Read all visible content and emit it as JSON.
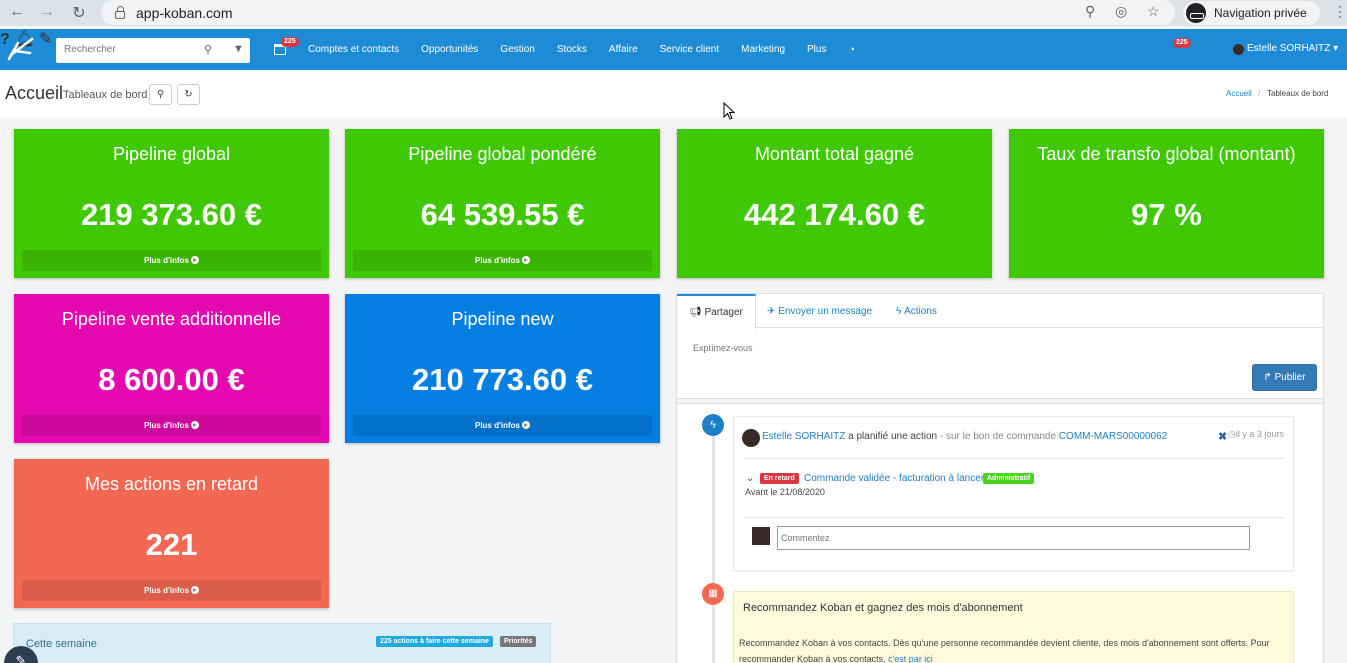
{
  "browser": {
    "url": "app-koban.com",
    "private_label": "Navigation privée"
  },
  "navbar": {
    "search_placeholder": "Rechercher",
    "calendar_badge": "225",
    "menu": [
      "Comptes et contacts",
      "Opportunités",
      "Gestion",
      "Stocks",
      "Affaire",
      "Service client",
      "Marketing",
      "Plus"
    ],
    "notif_badge": "225",
    "user_name": "Estelle SORHAITZ"
  },
  "page": {
    "title": "Accueil",
    "subtitle": "Tableaux de bord",
    "breadcrumb": [
      "Accueil",
      "Tableaux de bord"
    ]
  },
  "colors": {
    "brand_blue": "#1e8bd7",
    "kpi_green": "#41c804",
    "kpi_magenta": "#e40aaf",
    "kpi_blue": "#047ee0",
    "kpi_red": "#f26852",
    "late_red": "#d9363e",
    "admin_green": "#4bd31d"
  },
  "kpis": [
    {
      "title": "Pipeline global",
      "value": "219 373.60 €",
      "more": "Plus d'infos"
    },
    {
      "title": "Pipeline global pondéré",
      "value": "64 539.55 €",
      "more": "Plus d'infos"
    },
    {
      "title": "Montant total gagné",
      "value": "442 174.60 €",
      "more": ""
    },
    {
      "title": "Taux de transfo global (montant)",
      "value": "97 %",
      "more": ""
    },
    {
      "title": "Pipeline vente additionnelle",
      "value": "8 600.00 €",
      "more": "Plus d'infos"
    },
    {
      "title": "Pipeline new",
      "value": "210 773.60 €",
      "more": "Plus d'infos"
    },
    {
      "title": "Mes actions en retard",
      "value": "221",
      "more": "Plus d'infos"
    }
  ],
  "week": {
    "title": "Cette semaine",
    "actions_label": "225 actions à faire cette semaine",
    "priorities_label": "Priorités"
  },
  "social": {
    "tabs": [
      "Partager",
      "Envoyer un message",
      "Actions"
    ],
    "placeholder": "Exprimez-vous",
    "publish": "Publier",
    "post1": {
      "author": "Estelle SORHAITZ",
      "verb": " a planifié une action",
      "context": " - sur le bon de commande ",
      "ref": "COMM-MARS00000062",
      "ago": "il y a 3 jours",
      "late_tag": "En retard",
      "action": "Commande validée - facturation à lancer",
      "admin_tag": "Administratif",
      "before": "Avant le 21/08/2020",
      "comment_placeholder": "Commentez"
    },
    "post2": {
      "title": "Recommandez Koban et gagnez des mois d'abonnement",
      "text": "Recommandez Koban à vos contacts. Dès qu'une personne recommandée devient cliente, des mois d'abonnement sont offerts. Pour recommander Koban à vos contacts, ",
      "link": "c'est par ici"
    }
  }
}
